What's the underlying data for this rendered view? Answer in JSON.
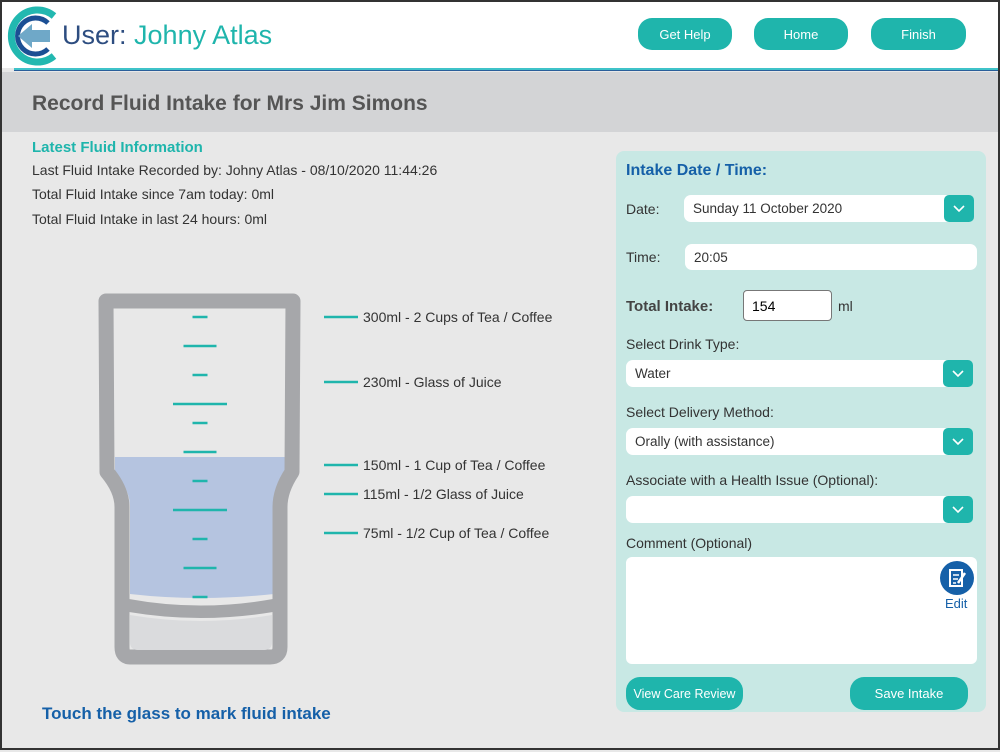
{
  "header": {
    "user_prefix": "User:",
    "user_name": "Johny Atlas",
    "buttons": [
      "Get Help",
      "Home",
      "Finish"
    ]
  },
  "page_title": "Record Fluid Intake for Mrs Jim Simons",
  "latest": {
    "heading": "Latest Fluid Information",
    "lines": [
      "Last Fluid Intake Recorded by: Johny Atlas - 08/10/2020 11:44:26",
      "Total Fluid Intake since 7am today: 0ml",
      "Total Fluid Intake in last 24 hours: 0ml"
    ]
  },
  "glass": {
    "fill_ml": 154,
    "max_ml": 300,
    "water_color": "#b5c4e0",
    "tick_color": "#1fb5ac",
    "marks": [
      "300ml - 2 Cups of Tea / Coffee",
      "230ml - Glass of Juice",
      "150ml - 1 Cup of Tea / Coffee",
      "115ml - 1/2 Glass of Juice",
      "75ml - 1/2 Cup of Tea / Coffee"
    ],
    "instruction": "Touch the glass to mark fluid intake"
  },
  "form": {
    "heading": "Intake Date / Time:",
    "date_label": "Date:",
    "date_value": "Sunday 11 October 2020",
    "time_label": "Time:",
    "time_value": "20:05",
    "total_label": "Total Intake:",
    "total_value": "154",
    "unit": "ml",
    "drink_label": "Select Drink Type:",
    "drink_value": "Water",
    "delivery_label": "Select Delivery Method:",
    "delivery_value": "Orally (with assistance)",
    "health_label": "Associate with a Health Issue (Optional):",
    "health_value": "",
    "comment_label": "Comment (Optional)",
    "edit_label": "Edit",
    "view_care_review": "View Care Review",
    "save_intake": "Save Intake"
  },
  "colors": {
    "accent": "#1fb5ac",
    "heading_blue": "#1560a8",
    "panel": "#c8e8e4"
  }
}
